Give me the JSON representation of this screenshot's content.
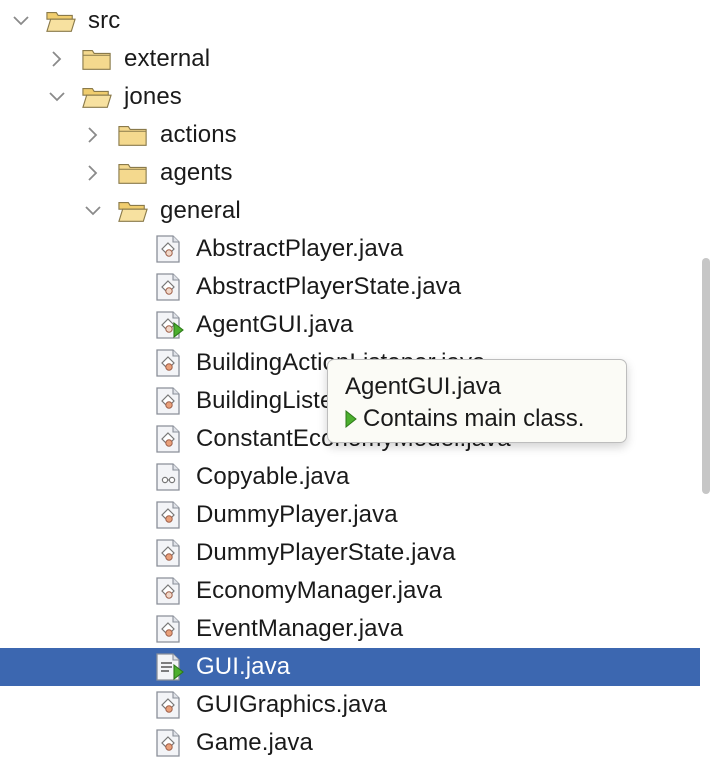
{
  "tree": {
    "nodes": [
      {
        "label": "src",
        "kind": "folder",
        "state": "expanded",
        "depth": 0
      },
      {
        "label": "external",
        "kind": "folder",
        "state": "collapsed",
        "depth": 1
      },
      {
        "label": "jones",
        "kind": "folder",
        "state": "expanded",
        "depth": 1
      },
      {
        "label": "actions",
        "kind": "folder",
        "state": "collapsed",
        "depth": 2
      },
      {
        "label": "agents",
        "kind": "folder",
        "state": "collapsed",
        "depth": 2
      },
      {
        "label": "general",
        "kind": "folder",
        "state": "expanded",
        "depth": 2
      },
      {
        "label": "AbstractPlayer.java",
        "kind": "abstract-class",
        "depth": 3
      },
      {
        "label": "AbstractPlayerState.java",
        "kind": "abstract-class",
        "depth": 3
      },
      {
        "label": "AgentGUI.java",
        "kind": "main-class",
        "depth": 3
      },
      {
        "label": "BuildingActionListener.java",
        "kind": "class",
        "depth": 3
      },
      {
        "label": "BuildingListener.java",
        "kind": "class",
        "depth": 3
      },
      {
        "label": "ConstantEconomyModel.java",
        "kind": "class",
        "depth": 3
      },
      {
        "label": "Copyable.java",
        "kind": "interface",
        "depth": 3
      },
      {
        "label": "DummyPlayer.java",
        "kind": "class",
        "depth": 3
      },
      {
        "label": "DummyPlayerState.java",
        "kind": "class",
        "depth": 3
      },
      {
        "label": "EconomyManager.java",
        "kind": "abstract-class",
        "depth": 3
      },
      {
        "label": "EventManager.java",
        "kind": "class",
        "depth": 3
      },
      {
        "label": "GUI.java",
        "kind": "main-class-doc",
        "depth": 3,
        "selected": true
      },
      {
        "label": "GUIGraphics.java",
        "kind": "class",
        "depth": 3
      },
      {
        "label": "Game.java",
        "kind": "class",
        "depth": 3
      }
    ]
  },
  "tooltip": {
    "title": "AgentGUI.java",
    "line": "Contains main class."
  },
  "colors": {
    "selection": "#3c67b0",
    "folder": "#f4d98e",
    "main_run": "#4caf2e",
    "tooltip_bg": "#fbfbf6"
  }
}
